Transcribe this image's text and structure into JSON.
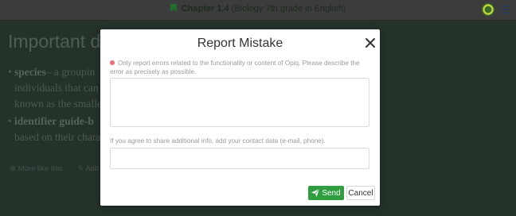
{
  "header": {
    "chapter_number": "Chapter 1.4",
    "chapter_subtitle": "(Biology 7th grade in English)"
  },
  "background_content": {
    "title": "Important de",
    "items": [
      {
        "term": "species",
        "line1": "– a groupin",
        "line2": "individuals that can",
        "line3": "known as the smalle"
      },
      {
        "term": "identifier guide-b",
        "line2": "based on their chara"
      }
    ],
    "links": [
      "More like this",
      "Add own"
    ]
  },
  "modal": {
    "title": "Report Mistake",
    "info_text": "Only report errors related to the functionality or content of Opiq. Please describe the error as precisely as possible.",
    "description_value": "",
    "contact_label": "If you agree to share additional info, add your contact data (e-mail, phone).",
    "contact_value": "",
    "send_label": "Send",
    "cancel_label": "Cancel"
  },
  "colors": {
    "accent_green": "#2e9e3e",
    "info_dot": "#e8717a",
    "overlay_bg": "#1f2a24"
  }
}
